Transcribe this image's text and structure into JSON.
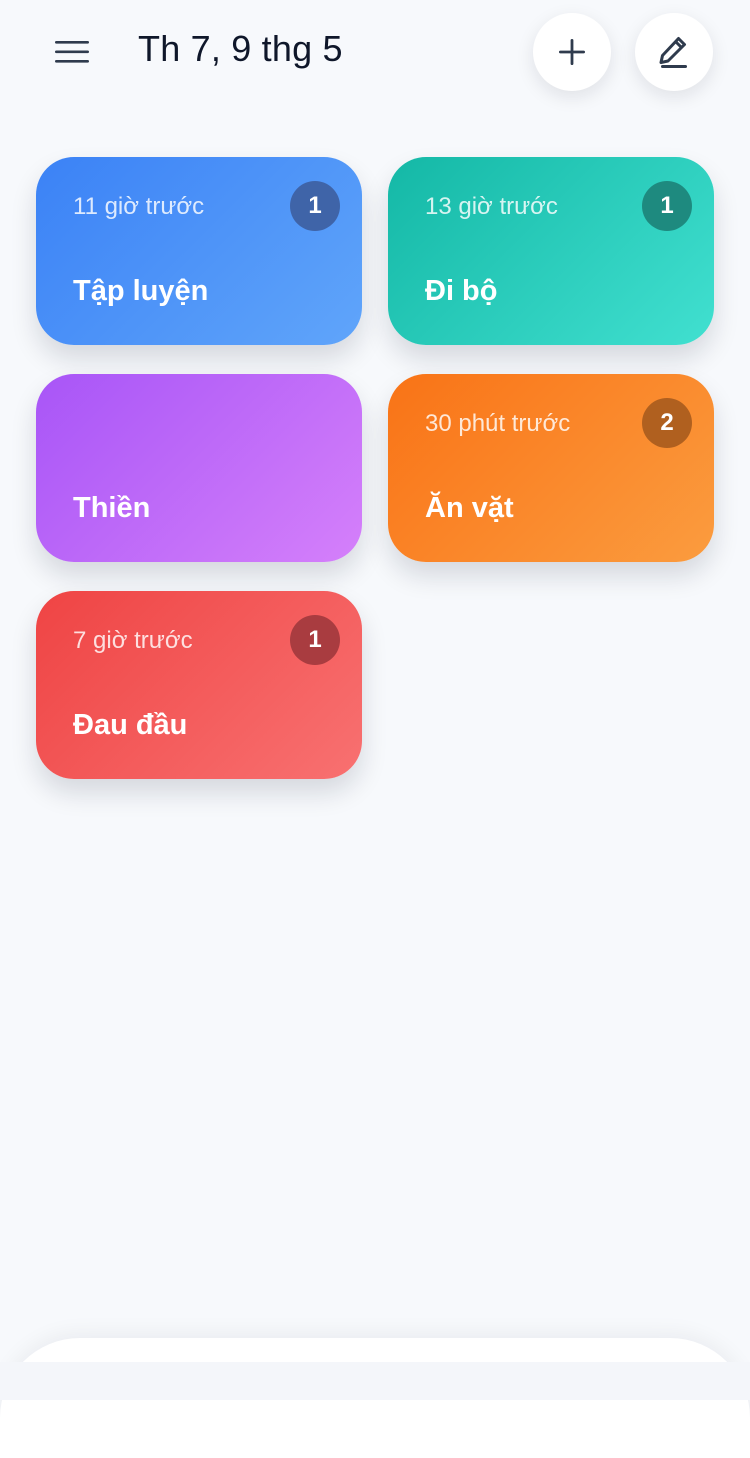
{
  "header": {
    "title": "Th 7, 9 thg 5",
    "menu_icon": "hamburger-menu-icon",
    "add_icon": "plus-icon",
    "edit_icon": "pencil-icon"
  },
  "cards": [
    {
      "subtitle": "11 giờ trước",
      "label": "Tập luyện",
      "badge": "1",
      "colors": {
        "start": "#3b82f6",
        "end": "#60a5fa",
        "badge": "#3f64a8"
      }
    },
    {
      "subtitle": "13 giờ trước",
      "label": "Đi bộ",
      "badge": "1",
      "colors": {
        "start": "#14b8a6",
        "end": "#41e0d0",
        "badge": "#1e8a7f"
      }
    },
    {
      "subtitle": "",
      "label": "Thiền",
      "badge": "",
      "colors": {
        "start": "#a855f7",
        "end": "#d580fa"
      }
    },
    {
      "subtitle": "30 phút trước",
      "label": "Ăn vặt",
      "badge": "2",
      "colors": {
        "start": "#f97316",
        "end": "#fb9c3f",
        "badge": "#b0601f"
      }
    },
    {
      "subtitle": "7 giờ trước",
      "label": "Đau đầu",
      "badge": "1",
      "colors": {
        "start": "#ef4444",
        "end": "#f87171",
        "badge": "#a93c40"
      }
    }
  ],
  "colors": {
    "background": "#f7f9fc",
    "title": "#0f172a",
    "icon": "#2f3b4d"
  }
}
